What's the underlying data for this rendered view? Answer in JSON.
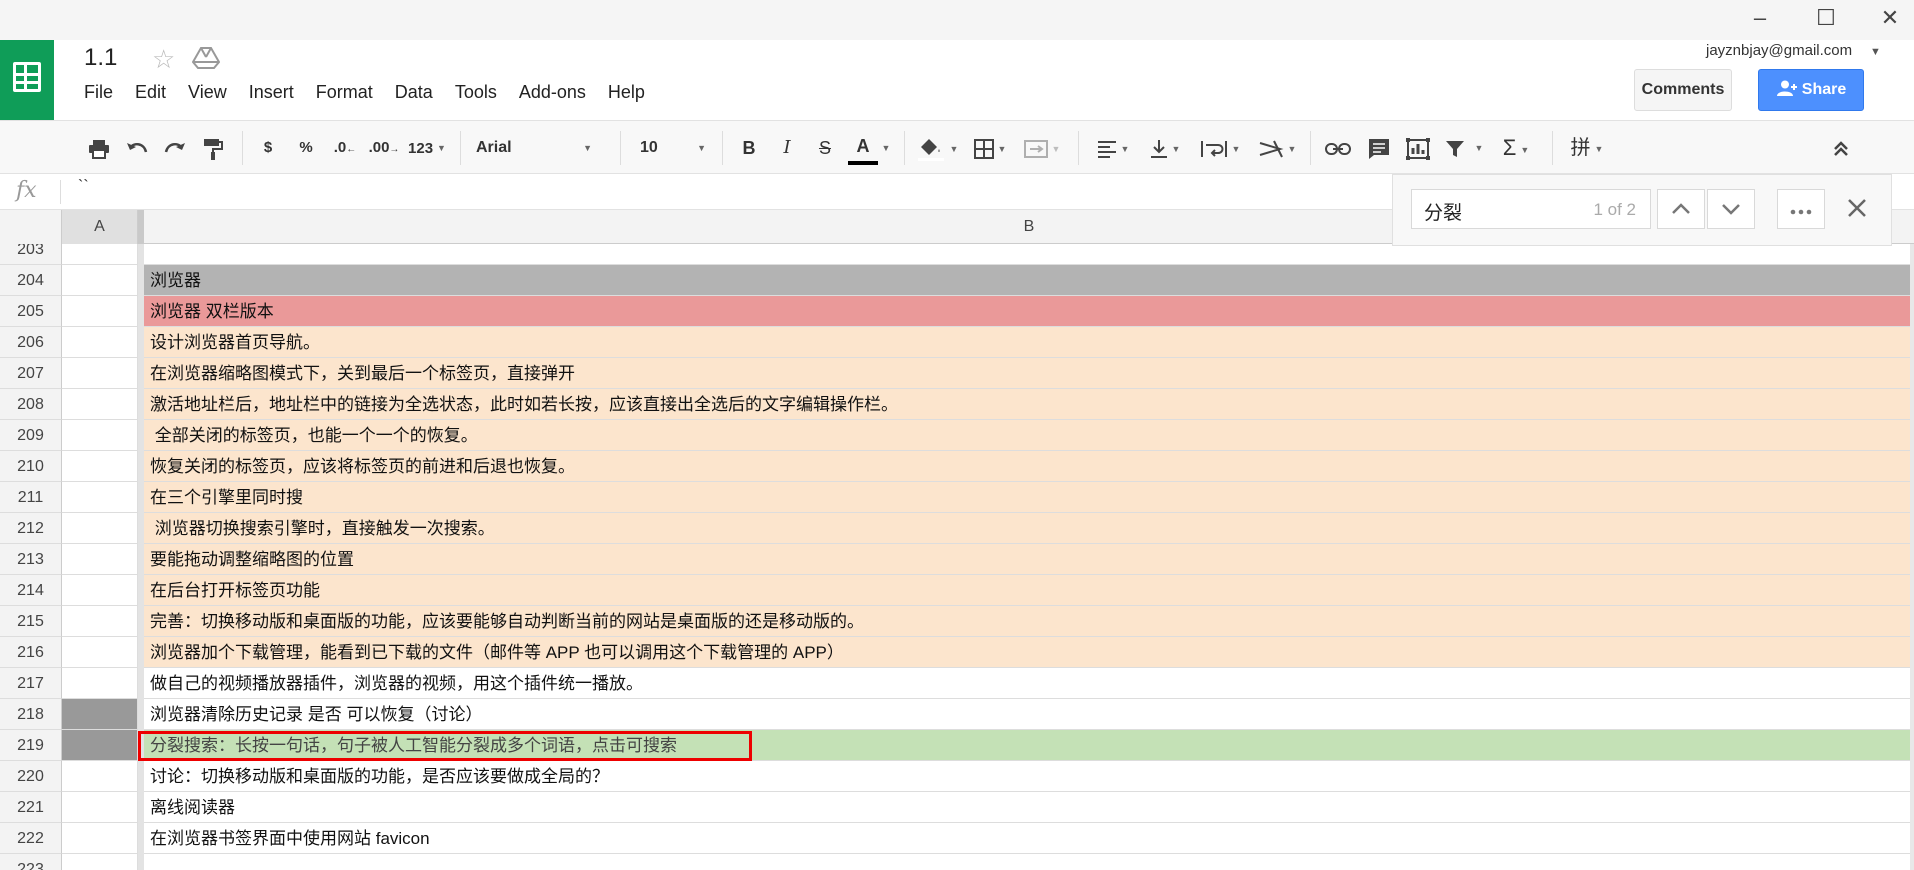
{
  "window": {
    "min_glyph": "–",
    "max_glyph": "☐",
    "close_glyph": "✕"
  },
  "header": {
    "doc_title": "1.1",
    "account": "jayznbjay@gmail.com",
    "comments_label": "Comments",
    "share_label": "Share",
    "menu": [
      "File",
      "Edit",
      "View",
      "Insert",
      "Format",
      "Data",
      "Tools",
      "Add-ons",
      "Help"
    ]
  },
  "toolbar": {
    "currency": "$",
    "percent": "%",
    "dec_decrease": ".0",
    "dec_increase": ".00",
    "more_formats": "123",
    "font": "Arial",
    "size": "10",
    "bold": "B",
    "italic": "I",
    "strike": "S",
    "text_color": "A",
    "sum": "Σ",
    "input_tools": "拼"
  },
  "formula": {
    "fx": "fx",
    "value": "``"
  },
  "find": {
    "query": "分裂",
    "count": "1 of 2"
  },
  "columns": {
    "a": "A",
    "b": "B"
  },
  "rows": [
    {
      "num": "203",
      "text": "",
      "style": "white",
      "a_sel": false
    },
    {
      "num": "204",
      "text": "浏览器",
      "style": "gray",
      "a_sel": false
    },
    {
      "num": "205",
      "text": "浏览器 双栏版本",
      "style": "red",
      "a_sel": false
    },
    {
      "num": "206",
      "text": "设计浏览器首页导航。",
      "style": "orange",
      "a_sel": false
    },
    {
      "num": "207",
      "text": "在浏览器缩略图模式下，关到最后一个标签页，直接弹开",
      "style": "orange",
      "a_sel": false
    },
    {
      "num": "208",
      "text": "激活地址栏后，地址栏中的链接为全选状态，此时如若长按，应该直接出全选后的文字编辑操作栏。",
      "style": "orange",
      "a_sel": false
    },
    {
      "num": "209",
      "text": " 全部关闭的标签页，也能一个一个的恢复。",
      "style": "orange",
      "a_sel": false
    },
    {
      "num": "210",
      "text": "恢复关闭的标签页，应该将标签页的前进和后退也恢复。",
      "style": "orange",
      "a_sel": false
    },
    {
      "num": "211",
      "text": "在三个引擎里同时搜",
      "style": "orange",
      "a_sel": false
    },
    {
      "num": "212",
      "text": " 浏览器切换搜索引擎时，直接触发一次搜索。",
      "style": "orange",
      "a_sel": false
    },
    {
      "num": "213",
      "text": "要能拖动调整缩略图的位置",
      "style": "orange",
      "a_sel": false
    },
    {
      "num": "214",
      "text": "在后台打开标签页功能",
      "style": "orange",
      "a_sel": false
    },
    {
      "num": "215",
      "text": "完善：切换移动版和桌面版的功能，应该要能够自动判断当前的网站是桌面版的还是移动版的。",
      "style": "orange",
      "a_sel": false
    },
    {
      "num": "216",
      "text": "浏览器加个下载管理，能看到已下载的文件（邮件等 APP 也可以调用这个下载管理的 APP）",
      "style": "orange",
      "a_sel": false
    },
    {
      "num": "217",
      "text": "做自己的视频播放器插件，浏览器的视频，用这个插件统一播放。",
      "style": "white",
      "a_sel": false
    },
    {
      "num": "218",
      "text": "浏览器清除历史记录 是否 可以恢复（讨论）",
      "style": "white",
      "a_sel": true
    },
    {
      "num": "219",
      "text": "分裂搜索：长按一句话，句子被人工智能分裂成多个词语，点击可搜索",
      "style": "green",
      "a_sel": true,
      "highlight": true
    },
    {
      "num": "220",
      "text": "讨论：切换移动版和桌面版的功能，是否应该要做成全局的？",
      "style": "white",
      "a_sel": false
    },
    {
      "num": "221",
      "text": "离线阅读器",
      "style": "white",
      "a_sel": false
    },
    {
      "num": "222",
      "text": "在浏览器书签界面中使用网站 favicon",
      "style": "white",
      "a_sel": false
    },
    {
      "num": "223",
      "text": "",
      "style": "white",
      "a_sel": false
    }
  ]
}
